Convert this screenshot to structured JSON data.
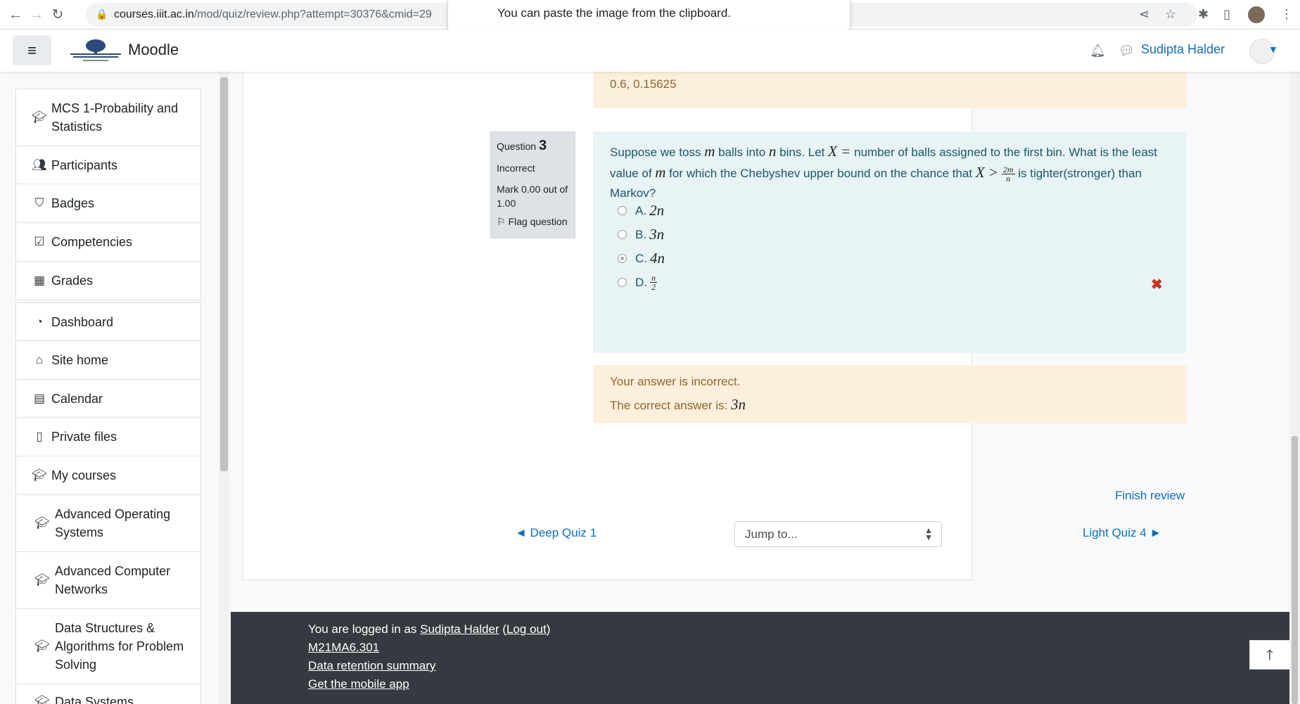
{
  "browser": {
    "url_host": "courses.iiit.ac.in",
    "url_rest": "/mod/quiz/review.php?attempt=30376&cmid=29",
    "paste_popup": "You can paste the image from the clipboard."
  },
  "navbar": {
    "brand": "Moodle",
    "user_name": "Sudipta Halder"
  },
  "sidebar": {
    "group1": [
      {
        "label": "MCS 1-Probability and Statistics",
        "icon": "graduation-cap-icon"
      },
      {
        "label": "Participants",
        "icon": "users-icon"
      },
      {
        "label": "Badges",
        "icon": "shield-icon"
      },
      {
        "label": "Competencies",
        "icon": "check-square-icon"
      },
      {
        "label": "Grades",
        "icon": "table-icon"
      }
    ],
    "group2": [
      {
        "label": "Dashboard",
        "icon": "dashboard-icon"
      },
      {
        "label": "Site home",
        "icon": "home-icon"
      },
      {
        "label": "Calendar",
        "icon": "calendar-icon"
      },
      {
        "label": "Private files",
        "icon": "file-icon"
      },
      {
        "label": "My courses",
        "icon": "graduation-cap-icon"
      },
      {
        "label": "Advanced Operating Systems",
        "icon": "graduation-cap-icon"
      },
      {
        "label": "Advanced Computer Networks",
        "icon": "graduation-cap-icon"
      },
      {
        "label": "Data Structures & Algorithms for Problem Solving",
        "icon": "graduation-cap-icon"
      },
      {
        "label": "Data Systems",
        "icon": "graduation-cap-icon"
      }
    ]
  },
  "previous_feedback": "0.6, 0.15625",
  "question": {
    "label": "Question",
    "number": "3",
    "state": "Incorrect",
    "mark": "Mark 0.00 out of 1.00",
    "flag": "Flag question",
    "text_parts": {
      "p1": "Suppose we toss ",
      "m": "m",
      "p2": " balls into ",
      "n": "n",
      "p3": " bins. Let ",
      "X": "X =",
      "p4": " number of balls assigned to the first bin. What is the least value of ",
      "m2": "m",
      "p5": " for which the Chebyshev upper bound on the chance that ",
      "X2": "X >",
      "frac_num": "2m",
      "frac_den": "n",
      "p6": " is tighter(stronger) than Markov?"
    },
    "options": [
      {
        "letter": "A.",
        "value": "2n",
        "selected": false
      },
      {
        "letter": "B.",
        "value": "3n",
        "selected": false
      },
      {
        "letter": "C.",
        "value": "4n",
        "selected": true
      },
      {
        "letter": "D.",
        "frac_num": "n",
        "frac_den": "2",
        "selected": false
      }
    ]
  },
  "feedback": {
    "line1": "Your answer is incorrect.",
    "line2_prefix": "The correct answer is: ",
    "line2_value": "3n"
  },
  "navigation": {
    "finish": "Finish review",
    "prev": "◄ Deep Quiz 1",
    "jump": "Jump to...",
    "next": "Light Quiz 4 ►"
  },
  "footer": {
    "logged_prefix": "You are logged in as ",
    "user": "Sudipta Halder",
    "logout": "Log out",
    "course_code": "M21MA6.301",
    "data_retention": "Data retention summary",
    "mobile_app": "Get the mobile app"
  }
}
